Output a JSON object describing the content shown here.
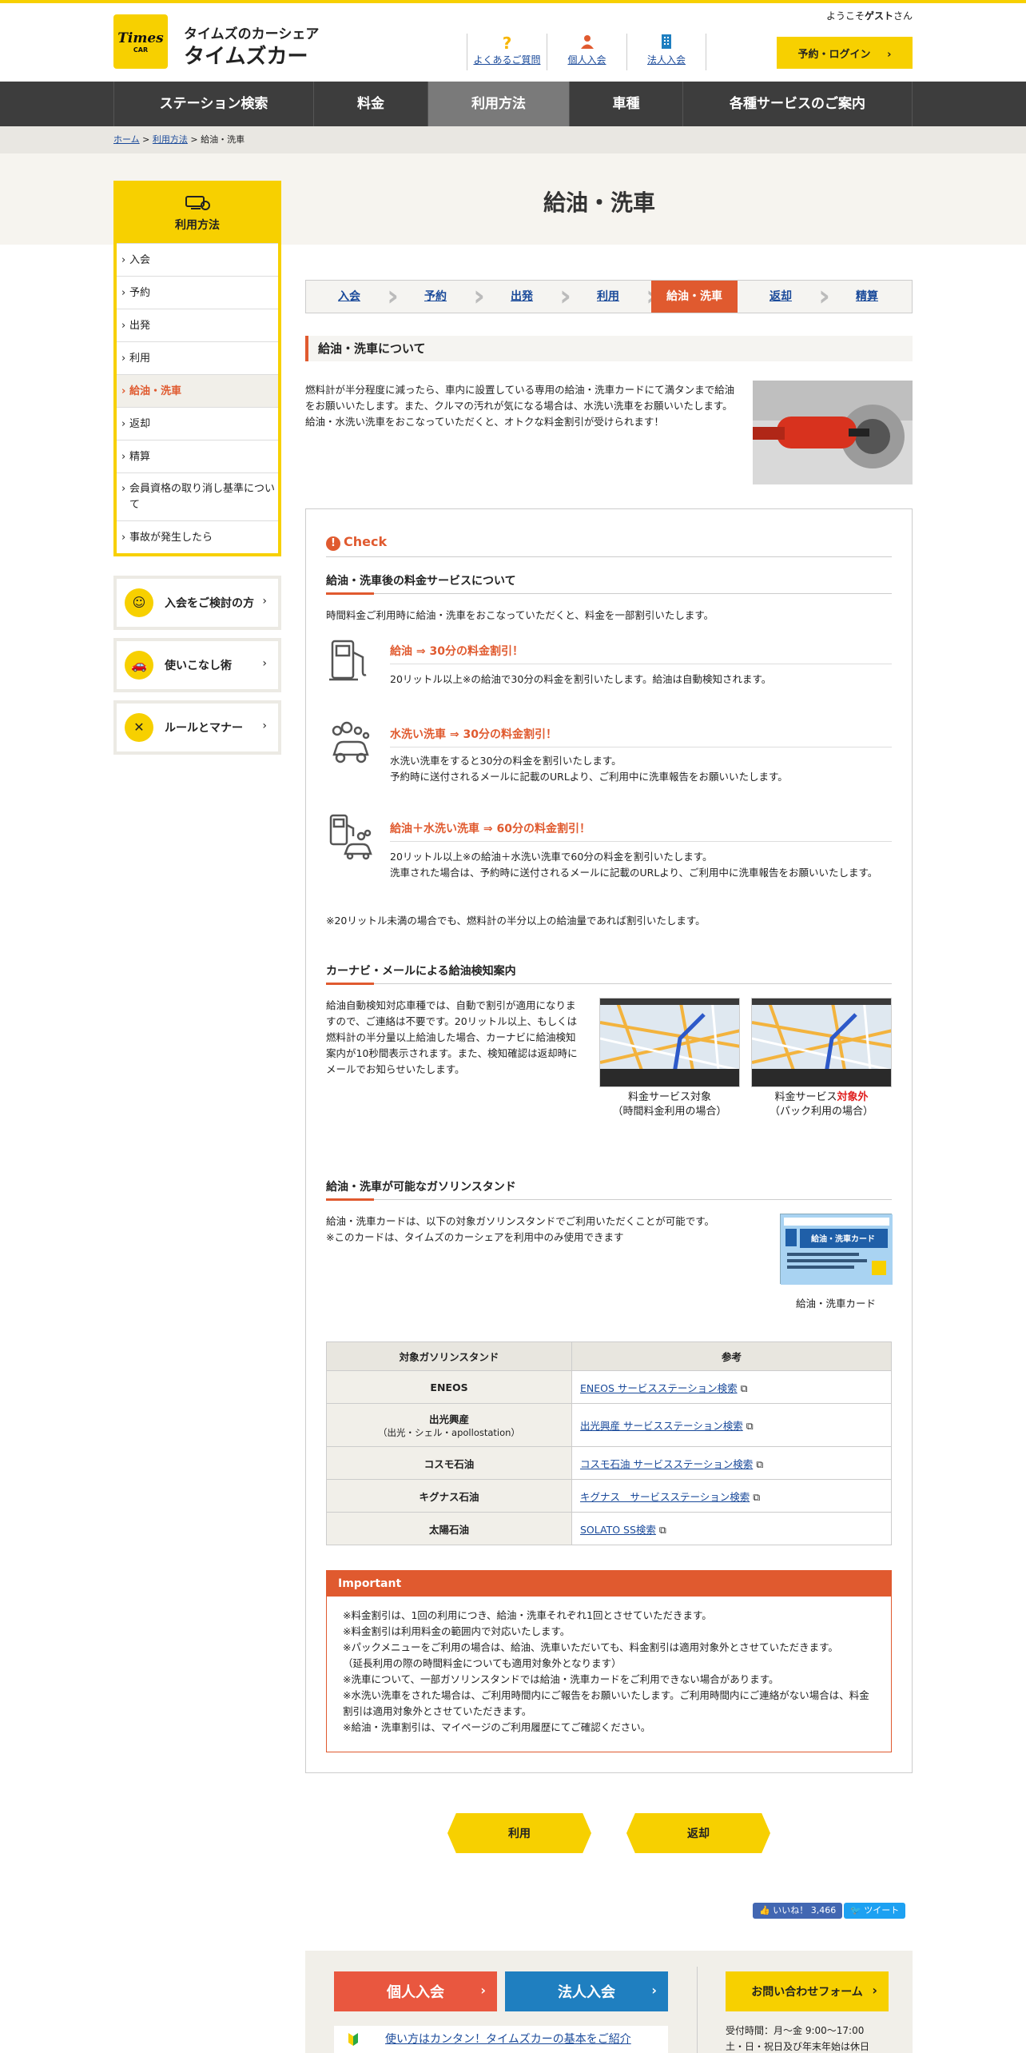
{
  "header": {
    "logo_main": "Times",
    "logo_sub": "CAR",
    "brand_sub": "タイムズのカーシェア",
    "brand_main": "タイムズカー",
    "welcome_prefix": "ようこそ",
    "welcome_user": "ゲスト",
    "welcome_suffix": "さん",
    "links": [
      {
        "label": "よくあるご質問",
        "icon": "question-icon"
      },
      {
        "label": "個人入会",
        "icon": "person-icon"
      },
      {
        "label": "法人入会",
        "icon": "building-icon"
      }
    ],
    "login_label": "予約・ログイン"
  },
  "gnav": [
    "ステーション検索",
    "料金",
    "利用方法",
    "車種",
    "各種サービスのご案内"
  ],
  "breadcrumb": {
    "home": "ホーム",
    "sep": " > ",
    "parent": "利用方法",
    "current": "給油・洗車"
  },
  "page_title": "給油・洗車",
  "sidebar": {
    "title": "利用方法",
    "items": [
      "入会",
      "予約",
      "出発",
      "利用",
      "給油・洗車",
      "返却",
      "精算",
      "会員資格の取り消し基準について",
      "事故が発生したら"
    ],
    "pills": [
      "入会をご検討の方",
      "使いこなし術",
      "ルールとマナー"
    ]
  },
  "steps": [
    "入会",
    "予約",
    "出発",
    "利用",
    "給油・洗車",
    "返却",
    "精算"
  ],
  "about": {
    "heading": "給油・洗車について",
    "text": "燃料計が半分程度に減ったら、車内に設置している専用の給油・洗車カードにて満タンまで給油をお願いいたします。また、クルマの汚れが気になる場合は、水洗い洗車をお願いいたします。給油・水洗い洗車をおこなっていただくと、オトクな料金割引が受けられます！"
  },
  "check": {
    "label": "Check",
    "section1": {
      "heading": "給油・洗車後の料金サービスについて",
      "lead": "時間料金ご利用時に給油・洗車をおこなっていただくと、料金を一部割引いたします。",
      "services": [
        {
          "title": "給油 ⇒ 30分の料金割引！",
          "lines": [
            "20リットル以上※の給油で30分の料金を割引いたします。給油は自動検知されます。"
          ]
        },
        {
          "title": "水洗い洗車 ⇒ 30分の料金割引！",
          "lines": [
            "水洗い洗車をすると30分の料金を割引いたします。",
            "予約時に送付されるメールに記載のURLより、ご利用中に洗車報告をお願いいたします。"
          ]
        },
        {
          "title": "給油＋水洗い洗車 ⇒ 60分の料金割引！",
          "lines": [
            "20リットル以上※の給油＋水洗い洗車で60分の料金を割引いたします。",
            "洗車された場合は、予約時に送付されるメールに記載のURLより、ご利用中に洗車報告をお願いいたします。"
          ]
        }
      ],
      "note": "※20リットル未満の場合でも、燃料計の半分以上の給油量であれば割引いたします。"
    },
    "section2": {
      "heading": "カーナビ・メールによる給油検知案内",
      "text": "給油自動検知対応車種では、自動で割引が適用になりますので、ご連絡は不要です。20リットル以上、もしくは燃料計の半分量以上給油した場合、カーナビに給油検知案内が10秒間表示されます。また、検知確認は返却時にメールでお知らせいたします。",
      "captions": [
        {
          "line1": "料金サービス対象",
          "line2": "（時間料金利用の場合）"
        },
        {
          "line1a": "料金サービス",
          "line1b": "対象外",
          "line2": "（パック利用の場合）"
        }
      ]
    },
    "section3": {
      "heading": "給油・洗車が可能なガソリンスタンド",
      "text1": "給油・洗車カードは、以下の対象ガソリンスタンドでご利用いただくことが可能です。",
      "text2": "※このカードは、タイムズのカーシェアを利用中のみ使用できます",
      "card_caption": "給油・洗車カード",
      "card_title": "給油・洗車カード",
      "table_headers": [
        "対象ガソリンスタンド",
        "参考"
      ],
      "table_rows": [
        {
          "name": "ENEOS",
          "sub": "",
          "link": "ENEOS サービスステーション検索"
        },
        {
          "name": "出光興産",
          "sub": "（出光・シェル・apollostation）",
          "link": "出光興産 サービスステーション検索"
        },
        {
          "name": "コスモ石油",
          "sub": "",
          "link": "コスモ石油 サービスステーション検索"
        },
        {
          "name": "キグナス石油",
          "sub": "",
          "link": "キグナス　サービスステーション検索"
        },
        {
          "name": "太陽石油",
          "sub": "",
          "link": "SOLATO SS検索"
        }
      ]
    },
    "important": {
      "label": "Important",
      "lines": [
        "※料金割引は、1回の利用につき、給油・洗車それぞれ1回とさせていただきます。",
        "※料金割引は利用料金の範囲内で対応いたします。",
        "※パックメニューをご利用の場合は、給油、洗車いただいても、料金割引は適用対象外とさせていただきます。",
        "（延長利用の際の時間料金についても適用対象外となります）",
        "※洗車について、一部ガソリンスタンドでは給油・洗車カードをご利用できない場合があります。",
        "※水洗い洗車をされた場合は、ご利用時間内にご報告をお願いいたします。ご利用時間内にご連絡がない場合は、料金割引は適用対象外とさせていただきます。",
        "※給油・洗車割引は、マイページのご利用履歴にてご確認ください。"
      ]
    }
  },
  "pager": {
    "prev": "利用",
    "next": "返却"
  },
  "social": {
    "like_label": "いいね！",
    "like_count": "3,466",
    "tweet_label": "ツイート"
  },
  "footer": {
    "individual": "個人入会",
    "corporate": "法人入会",
    "contact": "お問い合わせフォーム",
    "guide_link": "使い方はカンタン！タイムズカーの基本をご紹介",
    "hours1": "受付時間：月～金 9:00～17:00",
    "hours2": "土・日・祝日及び年末年始は休日"
  },
  "colors": {
    "accent": "#e05a2f",
    "brand_yellow": "#f7d000",
    "nav_bg": "#3d3d3d",
    "corporate_blue": "#1f7fc0",
    "individual_red": "#e9573f"
  }
}
